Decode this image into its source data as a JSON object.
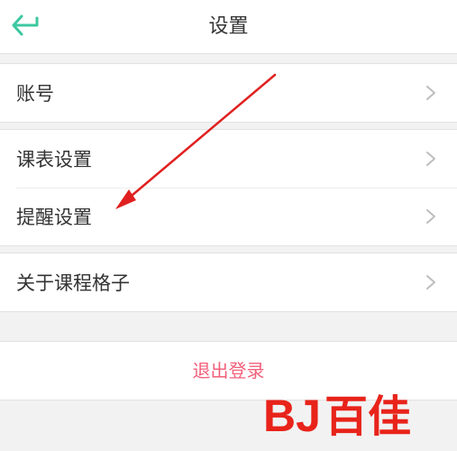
{
  "header": {
    "title": "设置",
    "back_icon": "back-arrow-icon"
  },
  "settings": {
    "account": "账号",
    "schedule_settings": "课表设置",
    "reminder_settings": "提醒设置",
    "about": "关于课程格子",
    "chevron_icon": "chevron-right-icon"
  },
  "logout": {
    "label": "退出登录"
  },
  "watermark": {
    "brand": "BJ百佳"
  },
  "colors": {
    "accent_green": "#3cc8a0",
    "logout_red": "#f2607a",
    "annotation_red": "#e02020",
    "watermark_red": "#e8231a"
  }
}
